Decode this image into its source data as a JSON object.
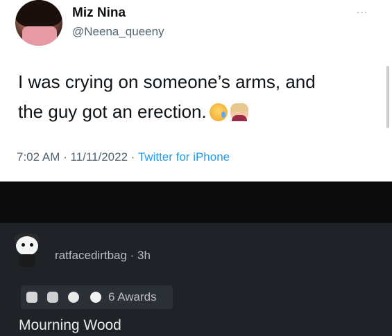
{
  "tweet": {
    "display_name": "Miz Nina",
    "handle": "@Neena_queeny",
    "more_label": "...",
    "text_line1": "I was crying on someone’s arms, and",
    "text_line2": "the guy got an erection.",
    "emoji": [
      "crying-face",
      "woman-facepalming"
    ],
    "timestamp": "7:02 AM · 11/11/2022 · ",
    "source": "Twitter for iPhone",
    "colors": {
      "background": "#ffffff",
      "text": "#0f1419",
      "secondary": "#536471",
      "link": "#1d9bf0"
    }
  },
  "reddit": {
    "username": "ratfacedirtbag · 3h",
    "awards_label": "6 Awards",
    "award_icons": [
      "silver-award-icon",
      "award-icon-2",
      "award-icon-3",
      "award-icon-4"
    ],
    "comment": "Mourning Wood",
    "colors": {
      "background": "#1f2328",
      "text": "#e6e8ea",
      "meta": "#b9bec3"
    }
  }
}
